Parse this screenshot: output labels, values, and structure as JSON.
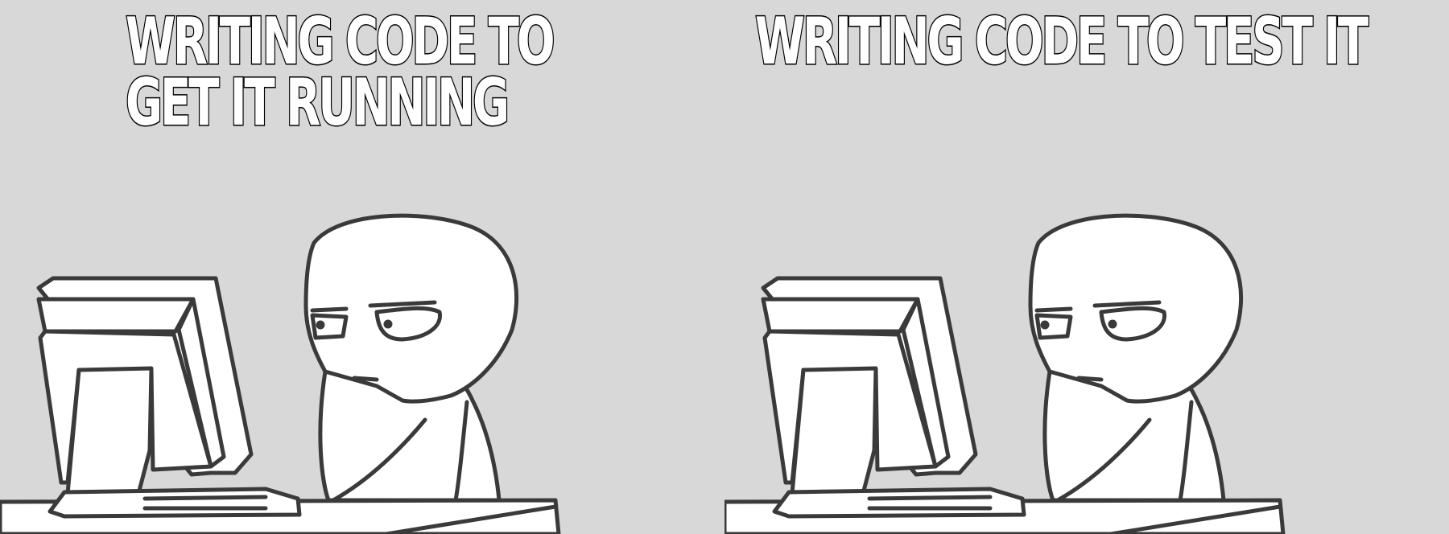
{
  "meme": {
    "left_panel": {
      "caption_line1": "WRITING CODE TO",
      "caption_line2": "GET IT RUNNING"
    },
    "right_panel": {
      "caption": "WRITING CODE TO TEST IT"
    }
  },
  "colors": {
    "background": "#d8d8d8",
    "outline": "#3a3a3a",
    "fill": "#ffffff"
  }
}
